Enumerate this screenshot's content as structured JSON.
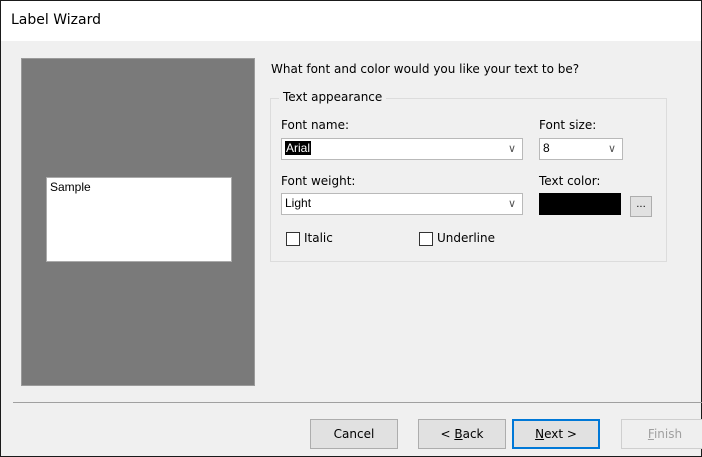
{
  "window": {
    "title": "Label Wizard"
  },
  "preview": {
    "sample_text": "Sample"
  },
  "question": "What font and color would you like your text to be?",
  "appearance": {
    "legend": "Text appearance",
    "font_name_label": "Font name:",
    "font_name_value": "Arial",
    "font_size_label": "Font size:",
    "font_size_value": "8",
    "font_weight_label": "Font weight:",
    "font_weight_value": "Light",
    "text_color_label": "Text color:",
    "text_color_value": "#000000",
    "italic_label": "Italic",
    "underline_label": "Underline",
    "ellipsis_label": "..."
  },
  "buttons": {
    "cancel": "Cancel",
    "back_prefix": "< ",
    "back_mnemonic": "B",
    "back_rest": "ack",
    "next_mnemonic": "N",
    "next_rest": "ext >",
    "finish_mnemonic": "F",
    "finish_rest": "inish"
  }
}
